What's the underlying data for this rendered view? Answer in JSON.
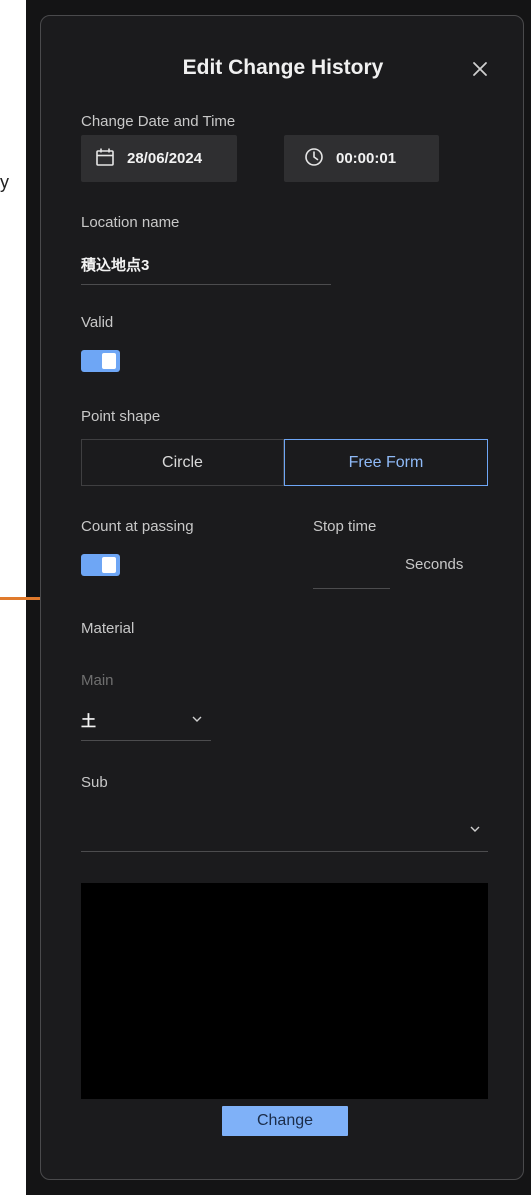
{
  "dialog": {
    "title": "Edit Change History",
    "close_icon": "close-icon"
  },
  "datetime": {
    "label": "Change Date and Time",
    "date": "28/06/2024",
    "time": "00:00:01",
    "date_icon": "calendar-icon",
    "time_icon": "clock-icon"
  },
  "location": {
    "label": "Location name",
    "value": "積込地点3"
  },
  "valid": {
    "label": "Valid",
    "on": true
  },
  "point_shape": {
    "label": "Point shape",
    "options": [
      "Circle",
      "Free Form"
    ],
    "selected": "Free Form"
  },
  "count_at_passing": {
    "label": "Count at passing",
    "on": true
  },
  "stop_time": {
    "label": "Stop time",
    "value": "",
    "unit": "Seconds"
  },
  "material": {
    "label": "Material",
    "main_label": "Main",
    "main_value": "土",
    "sub_label": "Sub",
    "sub_value": ""
  },
  "actions": {
    "change_label": "Change"
  },
  "colors": {
    "accent": "#6ea6f5",
    "button": "#7fb1f8",
    "panel": "#1b1b1d",
    "chip": "#2f2f31"
  }
}
